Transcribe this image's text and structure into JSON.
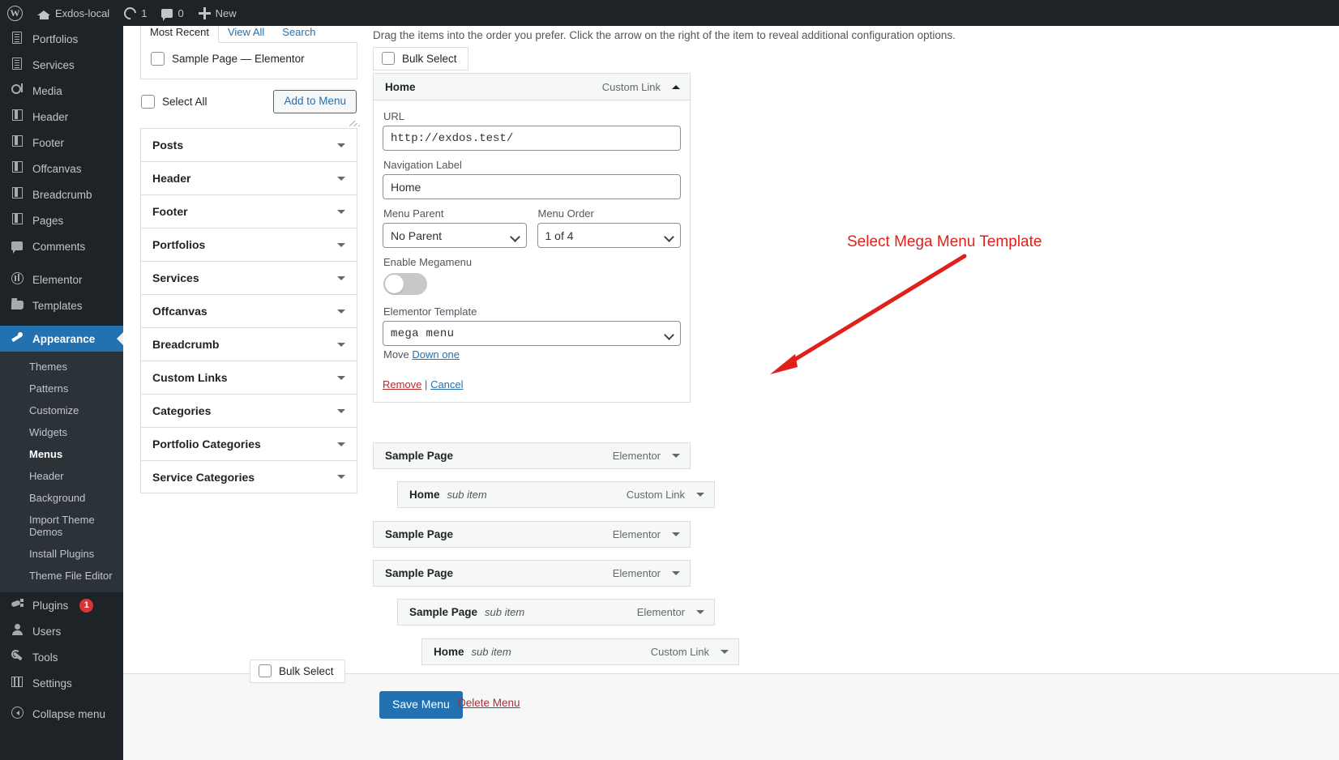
{
  "adminbar": {
    "site_name": "Exdos-local",
    "updates_count": "1",
    "comments_count": "0",
    "new_label": "New"
  },
  "sidebar": {
    "items": [
      {
        "label": "Portfolios",
        "icon": "document-icon"
      },
      {
        "label": "Services",
        "icon": "document-icon"
      },
      {
        "label": "Media",
        "icon": "media-icon"
      },
      {
        "label": "Header",
        "icon": "book-icon"
      },
      {
        "label": "Footer",
        "icon": "book-icon"
      },
      {
        "label": "Offcanvas",
        "icon": "book-icon"
      },
      {
        "label": "Breadcrumb",
        "icon": "book-icon"
      },
      {
        "label": "Pages",
        "icon": "book-icon"
      },
      {
        "label": "Comments",
        "icon": "comment-icon"
      },
      {
        "label": "Elementor",
        "icon": "elementor-icon"
      },
      {
        "label": "Templates",
        "icon": "folder-icon"
      },
      {
        "label": "Appearance",
        "icon": "brush-icon"
      }
    ],
    "appearance_submenu": [
      "Themes",
      "Patterns",
      "Customize",
      "Widgets",
      "Menus",
      "Header",
      "Background",
      "Import Theme Demos",
      "Install Plugins",
      "Theme File Editor"
    ],
    "appearance_active_sub": "Menus",
    "bottom_items": [
      {
        "label": "Plugins",
        "icon": "plug-icon",
        "badge": "1"
      },
      {
        "label": "Users",
        "icon": "user-icon",
        "badge": ""
      },
      {
        "label": "Tools",
        "icon": "wrench-icon",
        "badge": ""
      },
      {
        "label": "Settings",
        "icon": "settings-icon",
        "badge": ""
      }
    ],
    "collapse_label": "Collapse menu"
  },
  "available_items": {
    "tabs": [
      {
        "label": "Most Recent",
        "active": true
      },
      {
        "label": "View All",
        "active": false
      },
      {
        "label": "Search",
        "active": false
      }
    ],
    "entries": [
      "Sample Page — Elementor"
    ],
    "select_all_label": "Select All",
    "add_to_menu_label": "Add to Menu"
  },
  "accordion": [
    "Posts",
    "Header",
    "Footer",
    "Portfolios",
    "Services",
    "Offcanvas",
    "Breadcrumb",
    "Custom Links",
    "Categories",
    "Portfolio Categories",
    "Service Categories"
  ],
  "menu_structure": {
    "drag_hint": "Drag the items into the order you prefer. Click the arrow on the right of the item to reveal additional configuration options.",
    "bulk_select_label": "Bulk Select",
    "bulk_select_bottom_label": "Bulk Select",
    "editing_item": {
      "title": "Home",
      "type": "Custom Link",
      "url_label": "URL",
      "url_value": "http://exdos.test/",
      "nav_label_label": "Navigation Label",
      "nav_label_value": "Home",
      "menu_parent_label": "Menu Parent",
      "menu_parent_value": "No Parent",
      "menu_order_label": "Menu Order",
      "menu_order_value": "1 of 4",
      "enable_megamenu_label": "Enable Megamenu",
      "enable_megamenu_state": "off",
      "elementor_template_label": "Elementor Template",
      "elementor_template_value": "mega menu",
      "move_label": "Move",
      "move_link": "Down one",
      "remove_link": "Remove",
      "separator": "|",
      "cancel_link": "Cancel"
    },
    "items": [
      {
        "title": "Sample Page",
        "sub": "",
        "type": "Elementor",
        "depth": 0
      },
      {
        "title": "Home",
        "sub": "sub item",
        "type": "Custom Link",
        "depth": 1
      },
      {
        "title": "Sample Page",
        "sub": "",
        "type": "Elementor",
        "depth": 0
      },
      {
        "title": "Sample Page",
        "sub": "",
        "type": "Elementor",
        "depth": 0
      },
      {
        "title": "Sample Page",
        "sub": "sub item",
        "type": "Elementor",
        "depth": 1
      },
      {
        "title": "Home",
        "sub": "sub item",
        "type": "Custom Link",
        "depth": 2
      }
    ]
  },
  "footer_actions": {
    "save_label": "Save Menu",
    "delete_label": "Delete Menu"
  },
  "annotation": {
    "text": "Select Mega Menu Template",
    "color": "#e0201b"
  },
  "colors": {
    "admin_dark": "#1d2327",
    "admin_accent": "#2271b1",
    "badge_red": "#d63638",
    "danger": "#b32d2e"
  }
}
